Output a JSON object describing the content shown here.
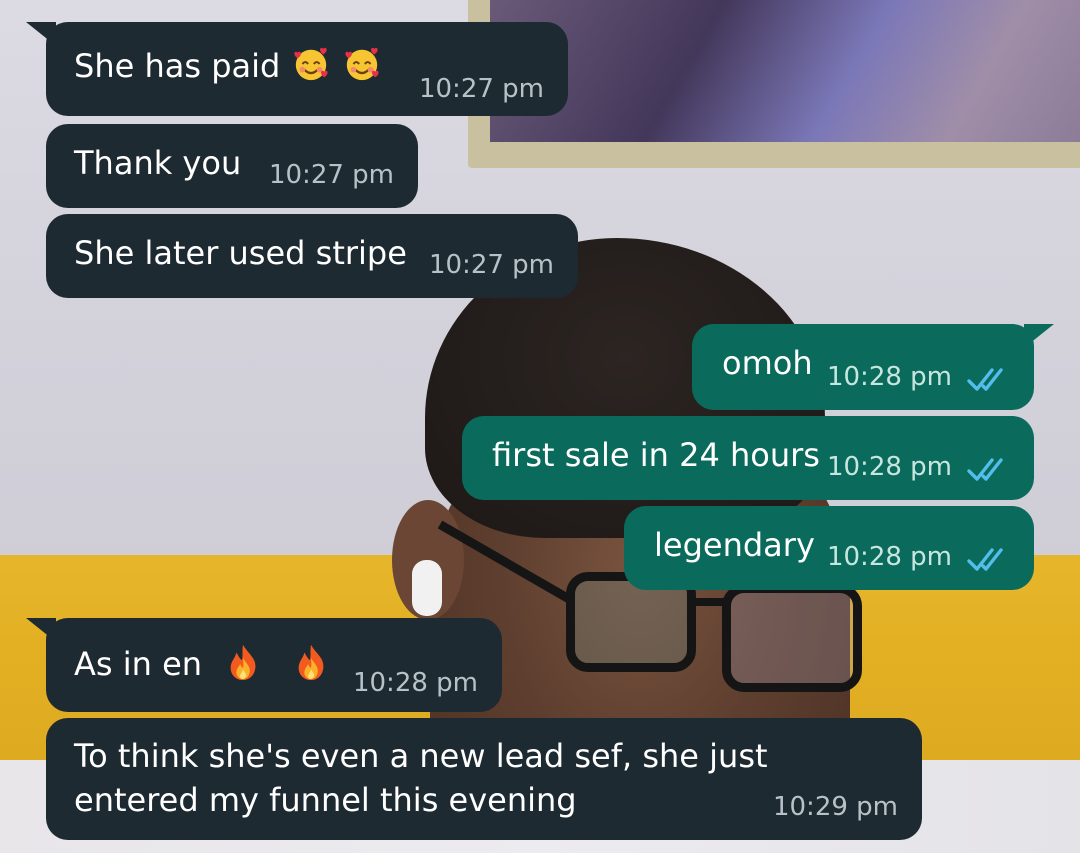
{
  "messages": [
    {
      "direction": "in",
      "text": "She has paid",
      "emojis": [
        "smiling-face-with-hearts",
        "smiling-face-with-hearts"
      ],
      "time": "10:27 pm"
    },
    {
      "direction": "in",
      "text": "Thank you",
      "time": "10:27 pm"
    },
    {
      "direction": "in",
      "text": "She later used stripe",
      "time": "10:27 pm"
    },
    {
      "direction": "out",
      "text": "omoh",
      "time": "10:28 pm",
      "status": "read"
    },
    {
      "direction": "out",
      "text": "first sale in 24 hours",
      "time": "10:28 pm",
      "status": "read"
    },
    {
      "direction": "out",
      "text": "legendary",
      "time": "10:28 pm",
      "status": "read"
    },
    {
      "direction": "in",
      "text": "As in en",
      "emojis": [
        "fire",
        "fire"
      ],
      "time": "10:28 pm"
    },
    {
      "direction": "in",
      "text": "To think she's even a new lead sef, she just entered my funnel this evening",
      "time": "10:29 pm"
    }
  ],
  "colors": {
    "incoming_bubble": "#1e2a31",
    "outgoing_bubble": "#0a6b5c",
    "read_ticks": "#53bdeb",
    "time_text": "#b7c1c6"
  }
}
